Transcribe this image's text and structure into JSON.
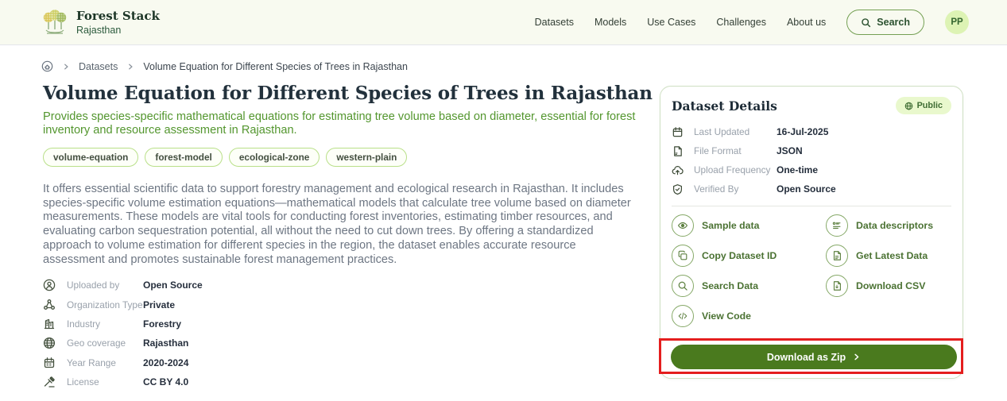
{
  "header": {
    "brand": {
      "title": "Forest Stack",
      "subtitle": "Rajasthan"
    },
    "nav": [
      "Datasets",
      "Models",
      "Use Cases",
      "Challenges",
      "About us"
    ],
    "search_label": "Search",
    "avatar_initials": "PP"
  },
  "breadcrumb": {
    "items": [
      "Datasets",
      "Volume Equation for Different Species of Trees in Rajasthan"
    ]
  },
  "main": {
    "title": "Volume Equation for Different Species of Trees in Rajasthan",
    "subtitle": "Provides species-specific mathematical equations for estimating tree volume based on diameter, essential for forest inventory and resource assessment in Rajasthan.",
    "tags": [
      "volume-equation",
      "forest-model",
      "ecological-zone",
      "western-plain"
    ],
    "description": "It offers essential scientific data to support forestry management and ecological research in Rajasthan. It includes species-specific volume estimation equations—mathematical models that calculate tree volume based on diameter measurements. These models are vital tools for conducting forest inventories, estimating timber resources, and evaluating carbon sequestration potential, all without the need to cut down trees. By offering a standardized approach to volume estimation for different species in the region, the dataset enables accurate resource assessment and promotes sustainable forest management practices.",
    "metadata": [
      {
        "icon": "user-icon",
        "label": "Uploaded by",
        "value": "Open Source"
      },
      {
        "icon": "org-icon",
        "label": "Organization Type",
        "value": "Private"
      },
      {
        "icon": "industry-icon",
        "label": "Industry",
        "value": "Forestry"
      },
      {
        "icon": "globe-icon",
        "label": "Geo coverage",
        "value": "Rajasthan"
      },
      {
        "icon": "calendar-icon",
        "label": "Year Range",
        "value": "2020-2024"
      },
      {
        "icon": "license-icon",
        "label": "License",
        "value": "CC BY 4.0"
      }
    ]
  },
  "details_card": {
    "title": "Dataset Details",
    "badge": "Public",
    "rows": [
      {
        "icon": "calendar-icon",
        "label": "Last Updated",
        "value": "16-Jul-2025"
      },
      {
        "icon": "file-icon",
        "label": "File Format",
        "value": "JSON"
      },
      {
        "icon": "cloud-upload-icon",
        "label": "Upload Frequency",
        "value": "One-time"
      },
      {
        "icon": "shield-check-icon",
        "label": "Verified By",
        "value": "Open Source"
      }
    ],
    "actions": [
      {
        "icon": "eye-icon",
        "label": "Sample data"
      },
      {
        "icon": "list-icon",
        "label": "Data descriptors"
      },
      {
        "icon": "copy-icon",
        "label": "Copy Dataset ID"
      },
      {
        "icon": "document-icon",
        "label": "Get Latest Data"
      },
      {
        "icon": "search-icon",
        "label": "Search Data"
      },
      {
        "icon": "file-download-icon",
        "label": "Download CSV"
      },
      {
        "icon": "code-icon",
        "label": "View Code"
      }
    ],
    "download_button": "Download as Zip"
  },
  "colors": {
    "accent_green": "#4a7a1e",
    "subtitle_green": "#53962e",
    "header_bg": "#f8faf0",
    "badge_bg": "#e9f8cd",
    "highlight_red": "#e41e1e"
  }
}
